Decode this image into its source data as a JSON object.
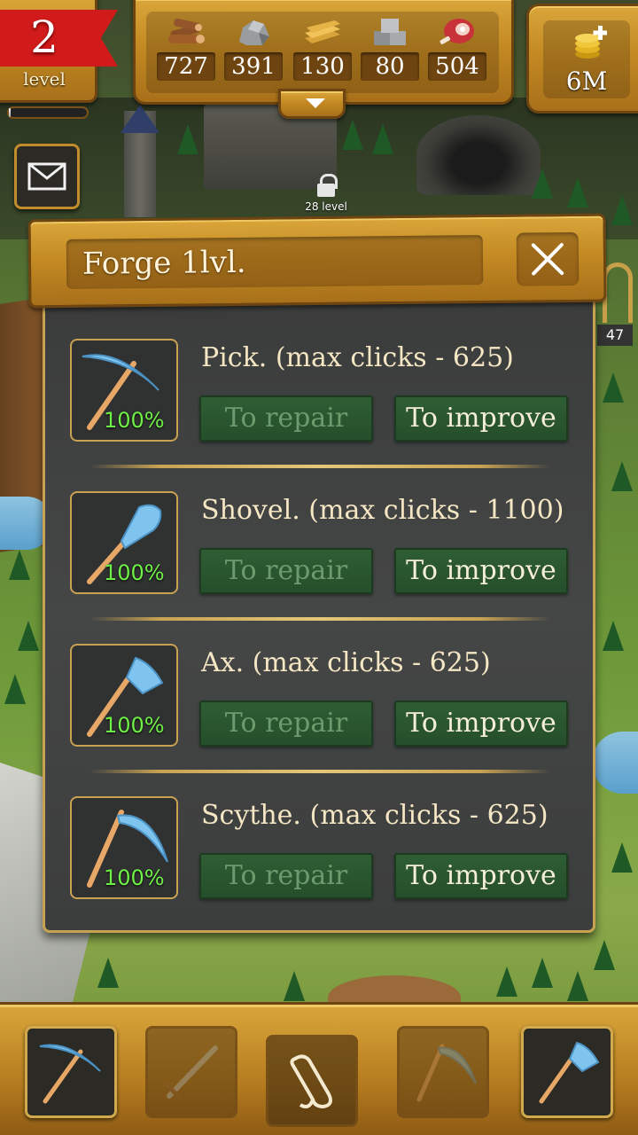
{
  "hud": {
    "level": {
      "number": "2",
      "label": "level",
      "progress": 0.02
    },
    "resources": [
      {
        "name": "wood-icon",
        "value": "727"
      },
      {
        "name": "stone-icon",
        "value": "391"
      },
      {
        "name": "planks-icon",
        "value": "130"
      },
      {
        "name": "stone-blocks-icon",
        "value": "80"
      },
      {
        "name": "meat-icon",
        "value": "504"
      }
    ],
    "gold": {
      "value": "6M",
      "icon": "gold-coins-plus-icon"
    }
  },
  "map": {
    "locked_label": "28 level",
    "side_tab_count": "47"
  },
  "dialog": {
    "title": "Forge 1lvl.",
    "tools": [
      {
        "name": "Pick. (max clicks - 625)",
        "percent": "100%",
        "icon": "pickaxe-icon",
        "repair_label": "To repair",
        "improve_label": "To improve"
      },
      {
        "name": "Shovel. (max clicks - 1100)",
        "percent": "100%",
        "icon": "shovel-icon",
        "repair_label": "To repair",
        "improve_label": "To improve"
      },
      {
        "name": "Ax. (max clicks - 625)",
        "percent": "100%",
        "icon": "axe-icon",
        "repair_label": "To repair",
        "improve_label": "To improve"
      },
      {
        "name": "Scythe. (max clicks - 625)",
        "percent": "100%",
        "icon": "scythe-icon",
        "repair_label": "To repair",
        "improve_label": "To improve"
      }
    ]
  },
  "bottom_bar": {
    "slots": [
      {
        "icon": "pickaxe-icon",
        "state": "active"
      },
      {
        "icon": "sword-icon",
        "state": "inactive"
      },
      {
        "icon": "scroll-icon",
        "state": "center"
      },
      {
        "icon": "scythe-icon",
        "state": "inactive"
      },
      {
        "icon": "axe-icon",
        "state": "active"
      }
    ]
  },
  "colors": {
    "wood_frame": "#c48a23",
    "panel_dark": "#414242",
    "accent_gold": "#c7a253",
    "button_green": "#2f5e34",
    "percent_green": "#6ff046",
    "level_red": "#d11a1a"
  }
}
